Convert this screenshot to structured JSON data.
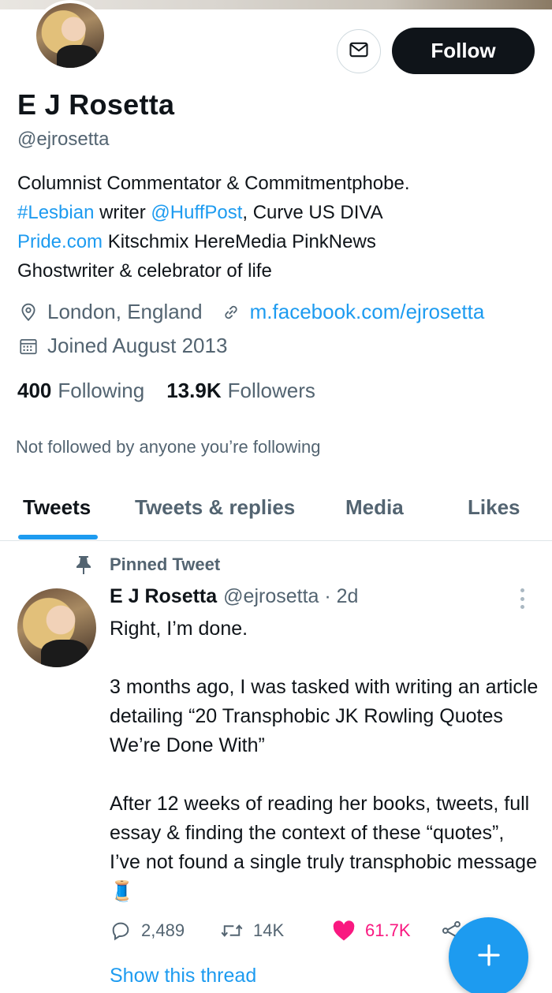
{
  "profile": {
    "name": "E J Rosetta",
    "handle": "@ejrosetta",
    "follow_label": "Follow",
    "bio": {
      "line1": "Columnist Commentator & Commitmentphobe.",
      "hashtag": "#Lesbian",
      "writer": " writer ",
      "mention": "@HuffPost",
      "line2_rest": ", Curve US DIVA",
      "site": "Pride.com",
      "line3_rest": " Kitschmix HereMedia PinkNews",
      "line4": "Ghostwriter & celebrator of life"
    },
    "location": "London, England",
    "website": "m.facebook.com/ejrosetta",
    "joined": "Joined August 2013",
    "following_count": "400",
    "following_label": "Following",
    "followers_count": "13.9K",
    "followers_label": "Followers",
    "not_followed": "Not followed by anyone you’re following"
  },
  "tabs": [
    "Tweets",
    "Tweets & replies",
    "Media",
    "Likes"
  ],
  "tweet": {
    "pinned_label": "Pinned Tweet",
    "author": "E J Rosetta",
    "meta": "@ejrosetta · 2d",
    "text": "Right, I’m done.\n\n3 months ago, I was tasked with writing an article detailing “20 Transphobic JK Rowling Quotes We’re Done With”\n\nAfter 12 weeks of reading her books, tweets, full essay & finding the context of these “quotes”, I’ve not found a single truly transphobic message🧵",
    "replies": "2,489",
    "retweets": "14K",
    "likes": "61.7K",
    "show_thread": "Show this thread"
  },
  "colors": {
    "accent": "#1d9bf0",
    "like": "#f91880",
    "text": "#0f1419",
    "muted": "#536471"
  },
  "icons": {
    "message": "envelope-icon",
    "location": "location-pin-icon",
    "link": "link-icon",
    "calendar": "calendar-icon",
    "pin": "pin-icon",
    "reply": "reply-icon",
    "retweet": "retweet-icon",
    "like": "heart-icon",
    "share": "share-icon",
    "compose": "plus-icon"
  }
}
